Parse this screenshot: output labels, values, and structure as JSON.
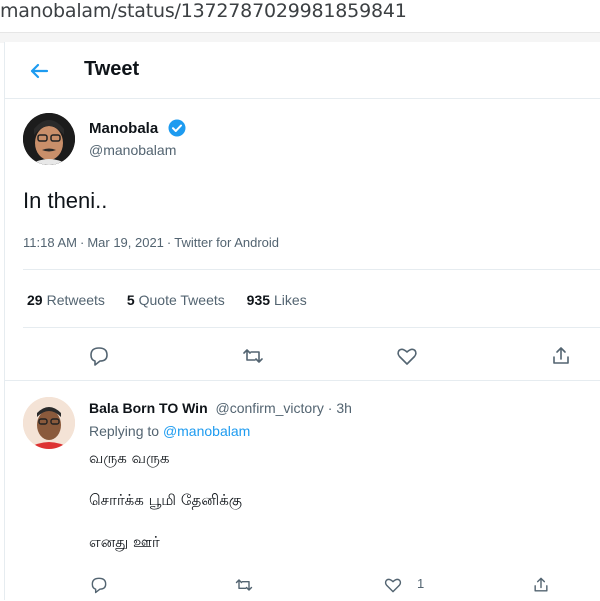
{
  "browser": {
    "url": "manobalam/status/1372787029981859841"
  },
  "header": {
    "back_icon": "arrow-left-icon",
    "title": "Tweet"
  },
  "tweet": {
    "author_name": "Manobala",
    "author_handle": "@manobalam",
    "verified": true,
    "text": "In theni..",
    "time": "11:18 AM",
    "date": "Mar 19, 2021",
    "source": "Twitter for Android",
    "meta_separator": "·",
    "stats": {
      "retweets_count": "29",
      "retweets_label": "Retweets",
      "quotes_count": "5",
      "quotes_label": "Quote Tweets",
      "likes_count": "935",
      "likes_label": "Likes"
    },
    "actions": [
      "reply-icon",
      "retweet-icon",
      "like-icon",
      "share-icon"
    ]
  },
  "reply": {
    "name": "Bala Born TO Win",
    "handle": "@confirm_victory",
    "separator": "·",
    "time": "3h",
    "replying_to_label": "Replying to",
    "replying_to_handle": "@manobalam",
    "lines": [
      "வருக வருக",
      "சொர்க்க பூமி தேனிக்கு",
      "எனது ஊர்"
    ],
    "like_count": "1"
  },
  "colors": {
    "accent": "#1d9bf0",
    "text": "#0f1419",
    "secondary": "#536471",
    "border": "#e6ecf0"
  }
}
